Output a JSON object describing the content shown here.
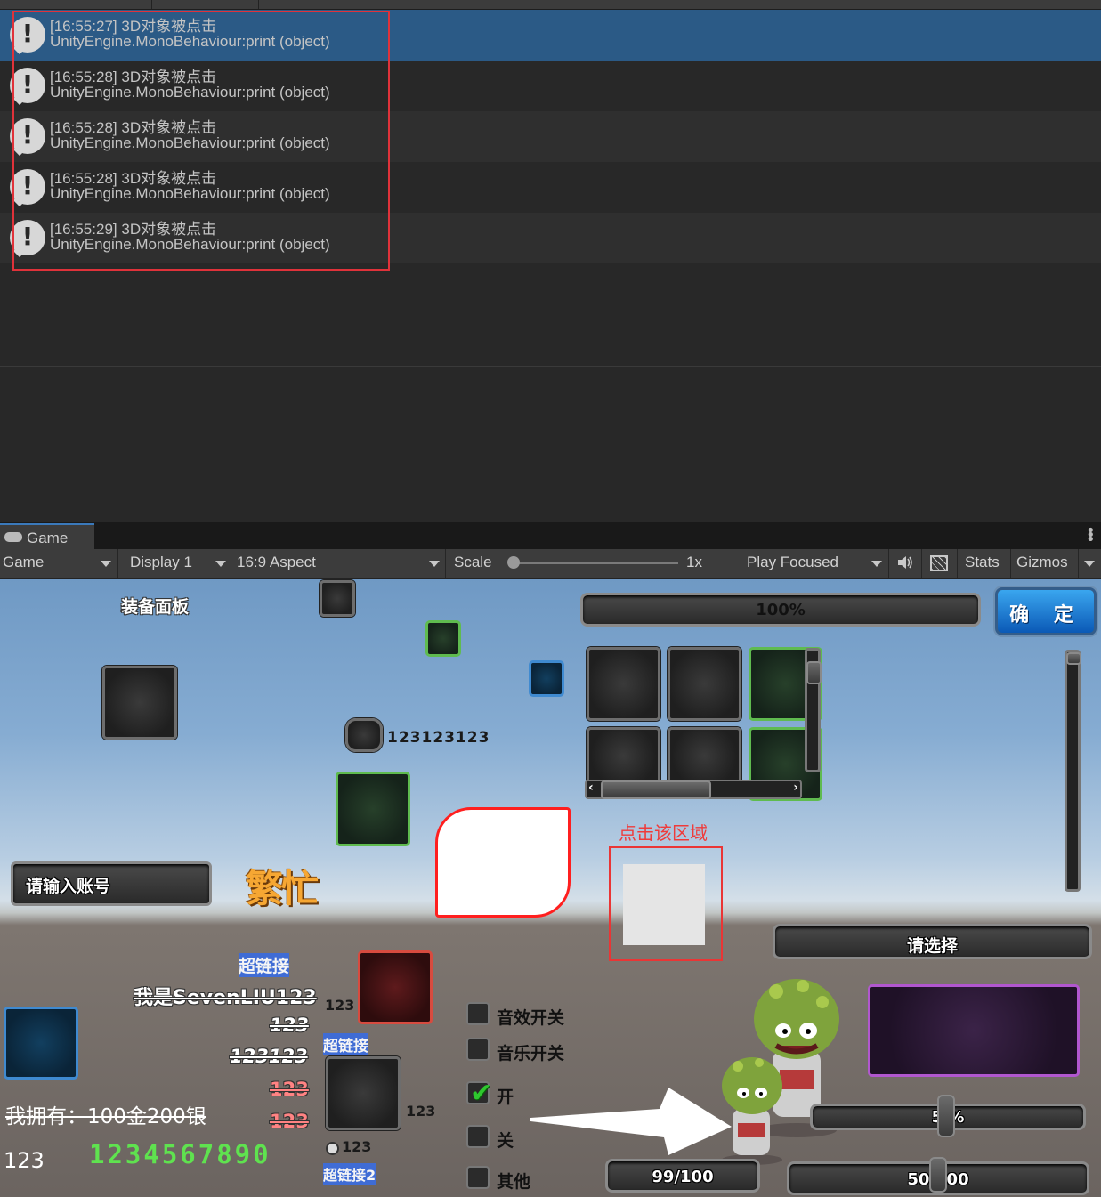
{
  "console": {
    "logs": [
      {
        "time": "[16:55:27]",
        "message": "3D对象被点击",
        "trace": "UnityEngine.MonoBehaviour:print (object)",
        "selected": true
      },
      {
        "time": "[16:55:28]",
        "message": "3D对象被点击",
        "trace": "UnityEngine.MonoBehaviour:print (object)",
        "selected": false
      },
      {
        "time": "[16:55:28]",
        "message": "3D对象被点击",
        "trace": "UnityEngine.MonoBehaviour:print (object)",
        "selected": false
      },
      {
        "time": "[16:55:28]",
        "message": "3D对象被点击",
        "trace": "UnityEngine.MonoBehaviour:print (object)",
        "selected": false
      },
      {
        "time": "[16:55:29]",
        "message": "3D对象被点击",
        "trace": "UnityEngine.MonoBehaviour:print (object)",
        "selected": false
      }
    ],
    "log_icon": "warning-bubble-icon",
    "highlight_color": "#e0323a"
  },
  "game_tab": {
    "tab_label": "Game",
    "tab_icon": "gamepad-icon",
    "toolbar": {
      "mode": "Game",
      "display": "Display 1",
      "aspect": "16:9 Aspect",
      "scale_label": "Scale",
      "scale_value": "1x",
      "play_mode": "Play Focused",
      "stats": "Stats",
      "gizmos": "Gizmos"
    }
  },
  "game_view": {
    "title": "装备面板",
    "progress_top": "100%",
    "confirm_button": "确 定",
    "number_row": "123123123",
    "click_hint": "点击该区域",
    "busy_text": "繁忙",
    "account_input_placeholder": "请输入账号",
    "dropdown": "请选择",
    "text_blocks": {
      "hl1": "超链接",
      "name": "我是SevenLIU123",
      "n1": "123",
      "n2": "123123",
      "n3": "123",
      "n4": "123",
      "hl2": "超链接",
      "own": "我拥有：100金200银",
      "plain": "123",
      "digits": "1234567890",
      "slot_label": "123",
      "slot_label2": "123",
      "radio_label": "123",
      "hl3": "超链接2"
    },
    "toggles": [
      {
        "label": "音效开关",
        "checked": false
      },
      {
        "label": "音乐开关",
        "checked": false
      },
      {
        "label": "开",
        "checked": true
      },
      {
        "label": "关",
        "checked": false
      },
      {
        "label": "其他",
        "checked": false
      }
    ],
    "slider_value": "5  %",
    "hp_bar": "99/100",
    "mp_bar": "50/100"
  }
}
